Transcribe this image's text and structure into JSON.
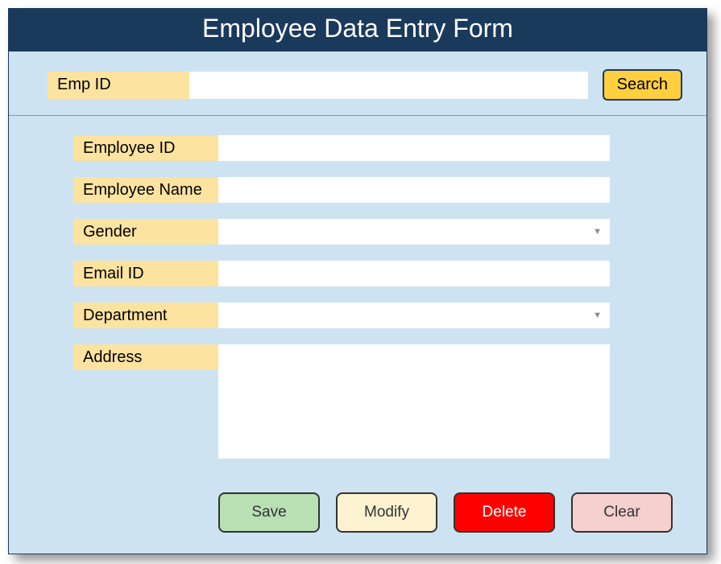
{
  "header": {
    "title": "Employee Data Entry Form"
  },
  "search": {
    "label": "Emp ID",
    "value": "",
    "button_label": "Search"
  },
  "fields": {
    "employee_id": {
      "label": "Employee ID",
      "value": ""
    },
    "employee_name": {
      "label": "Employee Name",
      "value": ""
    },
    "gender": {
      "label": "Gender",
      "value": ""
    },
    "email_id": {
      "label": "Email ID",
      "value": ""
    },
    "department": {
      "label": "Department",
      "value": ""
    },
    "address": {
      "label": "Address",
      "value": ""
    }
  },
  "buttons": {
    "save": "Save",
    "modify": "Modify",
    "delete": "Delete",
    "clear": "Clear"
  }
}
